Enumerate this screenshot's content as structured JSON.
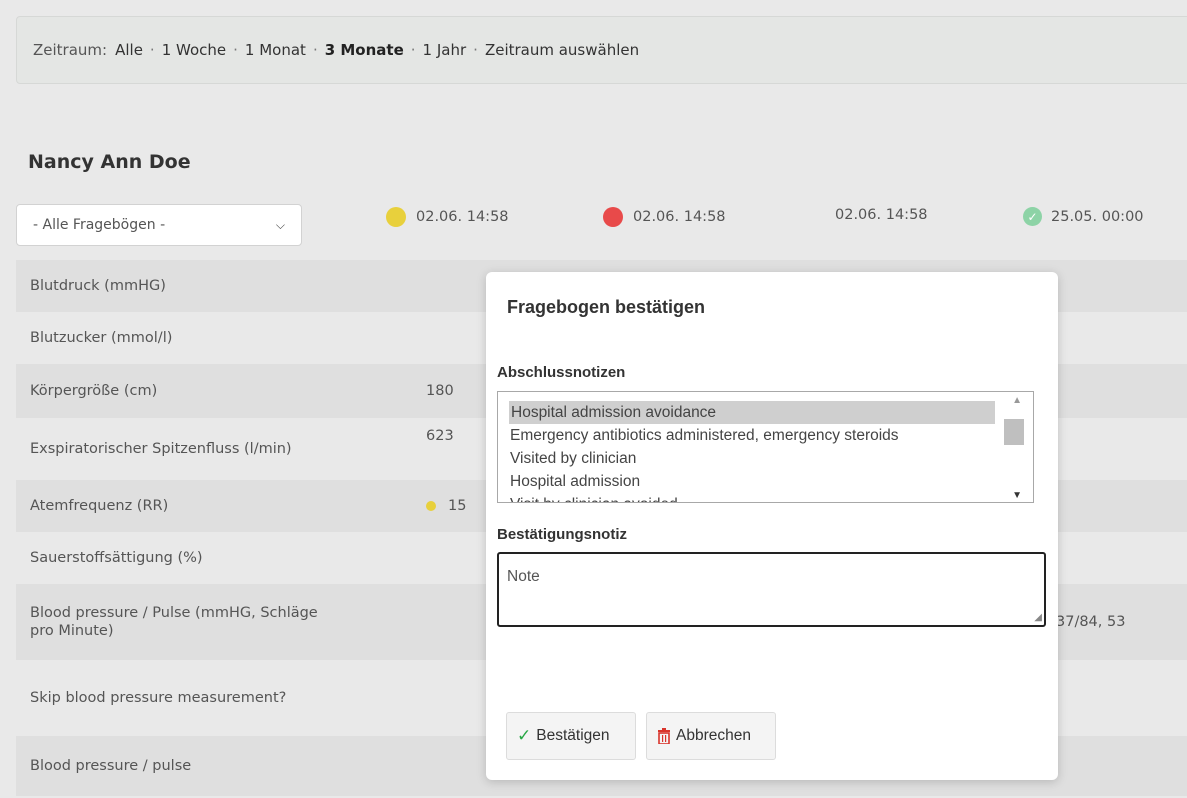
{
  "filter": {
    "label": "Zeitraum:",
    "options": [
      "Alle",
      "1 Woche",
      "1 Monat",
      "3 Monate",
      "1 Jahr",
      "Zeitraum auswählen"
    ],
    "active": "3 Monate"
  },
  "patient": {
    "name": "Nancy Ann Doe"
  },
  "questionnaire_select": {
    "value": "- Alle Fragebögen -"
  },
  "columns": [
    {
      "date": "02.06. 14:58",
      "status": "yellow"
    },
    {
      "date": "02.06. 14:58",
      "status": "red"
    },
    {
      "date": "02.06. 14:58",
      "status": "none"
    },
    {
      "date": "25.05. 00:00",
      "status": "green"
    }
  ],
  "rows": [
    {
      "label": "Blutdruck (mmHG)",
      "value": "",
      "value_right": ""
    },
    {
      "label": "Blutzucker (mmol/l)",
      "value": "",
      "value_right": ""
    },
    {
      "label": "Körpergröße (cm)",
      "value": "180",
      "value_right": ""
    },
    {
      "label": "Exspiratorischer Spitzenfluss (l/min)",
      "value": "623",
      "value_right": ""
    },
    {
      "label": "Atemfrequenz (RR)",
      "value": "15",
      "value_right": "",
      "dot": "yellow"
    },
    {
      "label": "Sauerstoffsättigung (%)",
      "value": "",
      "value_right": ""
    },
    {
      "label": "Blood pressure / Pulse (mmHG, Schläge pro Minute)",
      "value": "",
      "value_right": "37/84, 53"
    },
    {
      "label": "Skip blood pressure measurement?",
      "value": "",
      "value_right": ""
    },
    {
      "label": "Blood pressure / pulse",
      "value": "",
      "value_right": ""
    }
  ],
  "modal": {
    "title": "Fragebogen bestätigen",
    "notes_label": "Abschlussnotizen",
    "notes_options": [
      "Hospital admission avoidance",
      "Emergency antibiotics administered, emergency steroids",
      "Visited by clinician",
      "Hospital admission",
      "Visit by clinician avoided"
    ],
    "confirm_note_label": "Bestätigungsnotiz",
    "confirm_note_value": "Note",
    "confirm_button": "Bestätigen",
    "cancel_button": "Abbrechen"
  },
  "colors": {
    "yellow": "#e8d03c",
    "red": "#e84a4a",
    "green": "#8dd3a6",
    "confirm_icon": "#28a745",
    "cancel_icon": "#d9342b"
  }
}
